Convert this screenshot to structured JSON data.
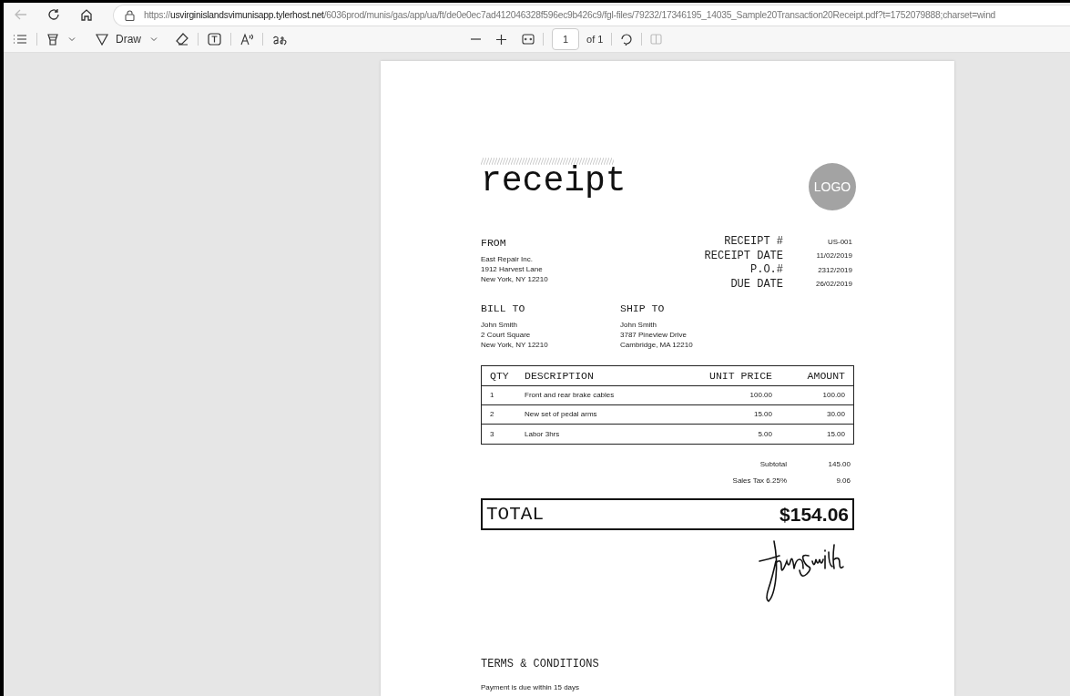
{
  "browser": {
    "url": "https://**usvirginislandsvimunisapp.tylerhost.net**/6036prod/munis/gas/app/ua/ft/de0e0ec7ad412046328f596ec9b426c9/fgl-files/79232/17346195_14035_Sample20Transaction20Receipt.pdf?t=1752079888;charset=wind",
    "back_disabled": true
  },
  "pdf_toolbar": {
    "draw_label": "Draw",
    "page_number": "1",
    "page_count": "of 1",
    "rotate_disabled": false,
    "two_page_disabled": true
  },
  "document": {
    "title": "receipt",
    "logo": "LOGO",
    "from": {
      "label": "FROM",
      "lines": [
        "East Repair Inc.",
        "1912 Harvest Lane",
        "New York, NY 12210"
      ]
    },
    "meta": [
      {
        "label": "RECEIPT #",
        "value": "US-001"
      },
      {
        "label": "RECEIPT DATE",
        "value": "11/02/2019"
      },
      {
        "label": "P.O.#",
        "value": "2312/2019"
      },
      {
        "label": "DUE DATE",
        "value": "26/02/2019"
      }
    ],
    "bill_to": {
      "label": "BILL TO",
      "lines": [
        "John Smith",
        "2 Court Square",
        "New York, NY 12210"
      ]
    },
    "ship_to": {
      "label": "SHIP TO",
      "lines": [
        "John Smith",
        "3787 Pineview Drive",
        "Cambridge, MA 12210"
      ]
    },
    "table": {
      "columns": [
        "QTY",
        "DESCRIPTION",
        "UNIT PRICE",
        "AMOUNT"
      ],
      "rows": [
        [
          "1",
          "Front and rear brake cables",
          "100.00",
          "100.00"
        ],
        [
          "2",
          "New set of pedal arms",
          "15.00",
          "30.00"
        ],
        [
          "3",
          "Labor 3hrs",
          "5.00",
          "15.00"
        ]
      ]
    },
    "totals": [
      {
        "label": "Subtotal",
        "value": "145.00"
      },
      {
        "label": "Sales Tax 6.25%",
        "value": "9.06"
      }
    ],
    "total": {
      "label": "TOTAL",
      "value": "$154.06"
    },
    "terms": {
      "label": "TERMS & CONDITIONS",
      "text": "Payment is due within 15 days"
    }
  }
}
